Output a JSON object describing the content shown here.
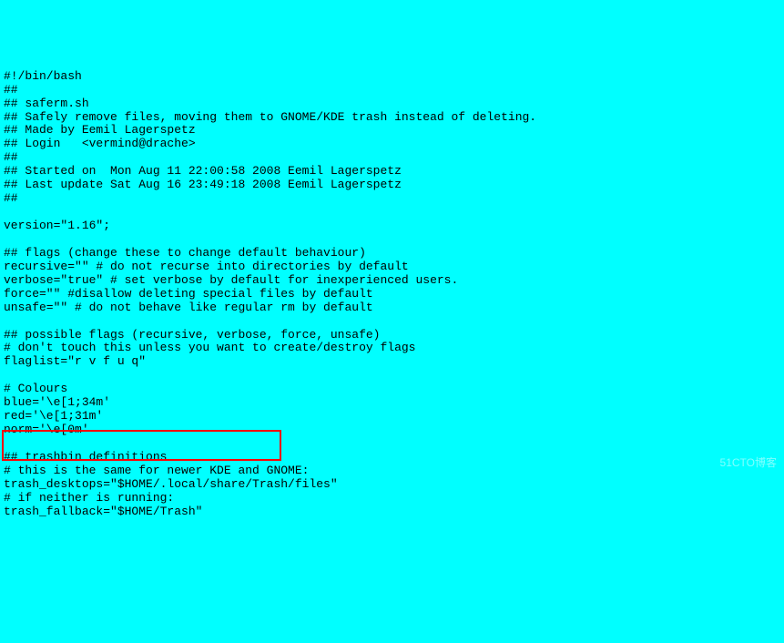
{
  "code": {
    "line1": "#!/bin/bash",
    "line2": "##",
    "line3": "## saferm.sh",
    "line4": "## Safely remove files, moving them to GNOME/KDE trash instead of deleting.",
    "line5": "## Made by Eemil Lagerspetz",
    "line6": "## Login   <vermind@drache>",
    "line7": "##",
    "line8": "## Started on  Mon Aug 11 22:00:58 2008 Eemil Lagerspetz",
    "line9": "## Last update Sat Aug 16 23:49:18 2008 Eemil Lagerspetz",
    "line10": "##",
    "line11": "",
    "line12": "version=\"1.16\";",
    "line13": "",
    "line14": "## flags (change these to change default behaviour)",
    "line15": "recursive=\"\" # do not recurse into directories by default",
    "line16": "verbose=\"true\" # set verbose by default for inexperienced users.",
    "line17": "force=\"\" #disallow deleting special files by default",
    "line18": "unsafe=\"\" # do not behave like regular rm by default",
    "line19": "",
    "line20": "## possible flags (recursive, verbose, force, unsafe)",
    "line21": "# don't touch this unless you want to create/destroy flags",
    "line22": "flaglist=\"r v f u q\"",
    "line23": "",
    "line24": "# Colours",
    "line25": "blue='\\e[1;34m'",
    "line26": "red='\\e[1;31m'",
    "line27": "norm='\\e[0m'",
    "line28": "",
    "line29": "## trashbin definitions",
    "line30": "# this is the same for newer KDE and GNOME:",
    "line31": "trash_desktops=\"$HOME/.local/share/Trash/files\"",
    "line32": "# if neither is running:",
    "line33": "trash_fallback=\"$HOME/Trash\""
  },
  "watermark": "51CTO博客"
}
